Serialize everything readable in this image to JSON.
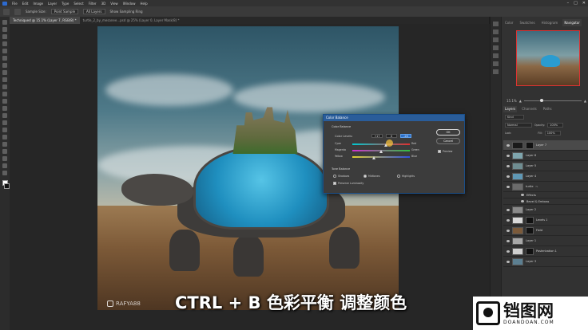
{
  "menubar": {
    "items": [
      "File",
      "Edit",
      "Image",
      "Layer",
      "Type",
      "Select",
      "Filter",
      "3D",
      "View",
      "Window",
      "Help"
    ]
  },
  "optionsbar": {
    "sample_label": "Sample Size:",
    "sample_value": "Point Sample",
    "sample_all": "All Layers",
    "show_ring": "Show Sampling Ring"
  },
  "tabs": [
    {
      "label": "Techniqued @ 15.1% (Layer 7, RGB/8) *",
      "active": true
    },
    {
      "label": "turtle_2_by_mesanee...psd @ 25% (Layer 0, Layer Mask/8) *",
      "active": false
    }
  ],
  "watermark": "RAFYA88",
  "subtitle": "CTRL + B 色彩平衡 调整颜色",
  "brand": {
    "cn": "铛图网",
    "en": "DOANDOAN.COM"
  },
  "panels": {
    "tabs": [
      "Color",
      "Swatches",
      "Histogram",
      "Navigator"
    ],
    "active_tab": "Navigator",
    "zoom": "15.1%",
    "layer_tabs": [
      "Layers",
      "Channels",
      "Paths"
    ],
    "active_layer_tab": "Layers",
    "kind": "Kind",
    "blend": "Normal",
    "opacity_label": "Opacity:",
    "opacity": "100%",
    "lock_label": "Lock:",
    "fill_label": "Fill:",
    "fill": "100%"
  },
  "layers": [
    {
      "name": "Layer 7",
      "selected": true,
      "thumb": "#1a1a1a",
      "mask": true
    },
    {
      "name": "Layer 6",
      "selected": false,
      "thumb": "#7ea5ad",
      "mask": false
    },
    {
      "name": "Layer 5",
      "selected": false,
      "thumb": "#6f8d91",
      "mask": false
    },
    {
      "name": "Layer 4",
      "selected": false,
      "thumb": "#5f98b5",
      "mask": false
    },
    {
      "name": "turtle",
      "selected": false,
      "thumb": "#6b6b6b",
      "mask": false,
      "sub": "fx"
    },
    {
      "name": "Effects",
      "selected": false,
      "thumb": null,
      "mask": false,
      "sub": "effect"
    },
    {
      "name": "Bevel & Emboss",
      "selected": false,
      "thumb": null,
      "mask": false,
      "sub": "effect"
    },
    {
      "name": "Layer 2",
      "selected": false,
      "thumb": "#8a8a8a",
      "mask": false
    },
    {
      "name": "Levels 1",
      "selected": false,
      "thumb": "#d8d8d8",
      "mask": true
    },
    {
      "name": "Field",
      "selected": false,
      "thumb": "#7b5a3a",
      "mask": true
    },
    {
      "name": "Layer 1",
      "selected": false,
      "thumb": "#a7a7a7",
      "mask": false
    },
    {
      "name": "Posterization 1",
      "selected": false,
      "thumb": "#cfcfcf",
      "mask": true
    },
    {
      "name": "Layer 3",
      "selected": false,
      "thumb": "#5c7f91",
      "mask": false
    }
  ],
  "dialog": {
    "title": "Color Balance",
    "group1": "Color Balance",
    "color_levels_label": "Color Levels:",
    "levels": [
      "+17",
      "0",
      "-26"
    ],
    "active_level": 2,
    "sliders": [
      {
        "left": "Cyan",
        "right": "Red",
        "value": 17
      },
      {
        "left": "Magenta",
        "right": "Green",
        "value": 0
      },
      {
        "left": "Yellow",
        "right": "Blue",
        "value": -26
      }
    ],
    "group2": "Tone Balance",
    "tones": [
      "Shadows",
      "Midtones",
      "Highlights"
    ],
    "selected_tone": "Midtones",
    "preserve": "Preserve Luminosity",
    "preserve_checked": true,
    "ok": "OK",
    "cancel": "Cancel",
    "preview": "Preview",
    "preview_checked": true
  },
  "colors": {
    "accent": "#2a5d9a",
    "shell": "#2a9cd0"
  }
}
